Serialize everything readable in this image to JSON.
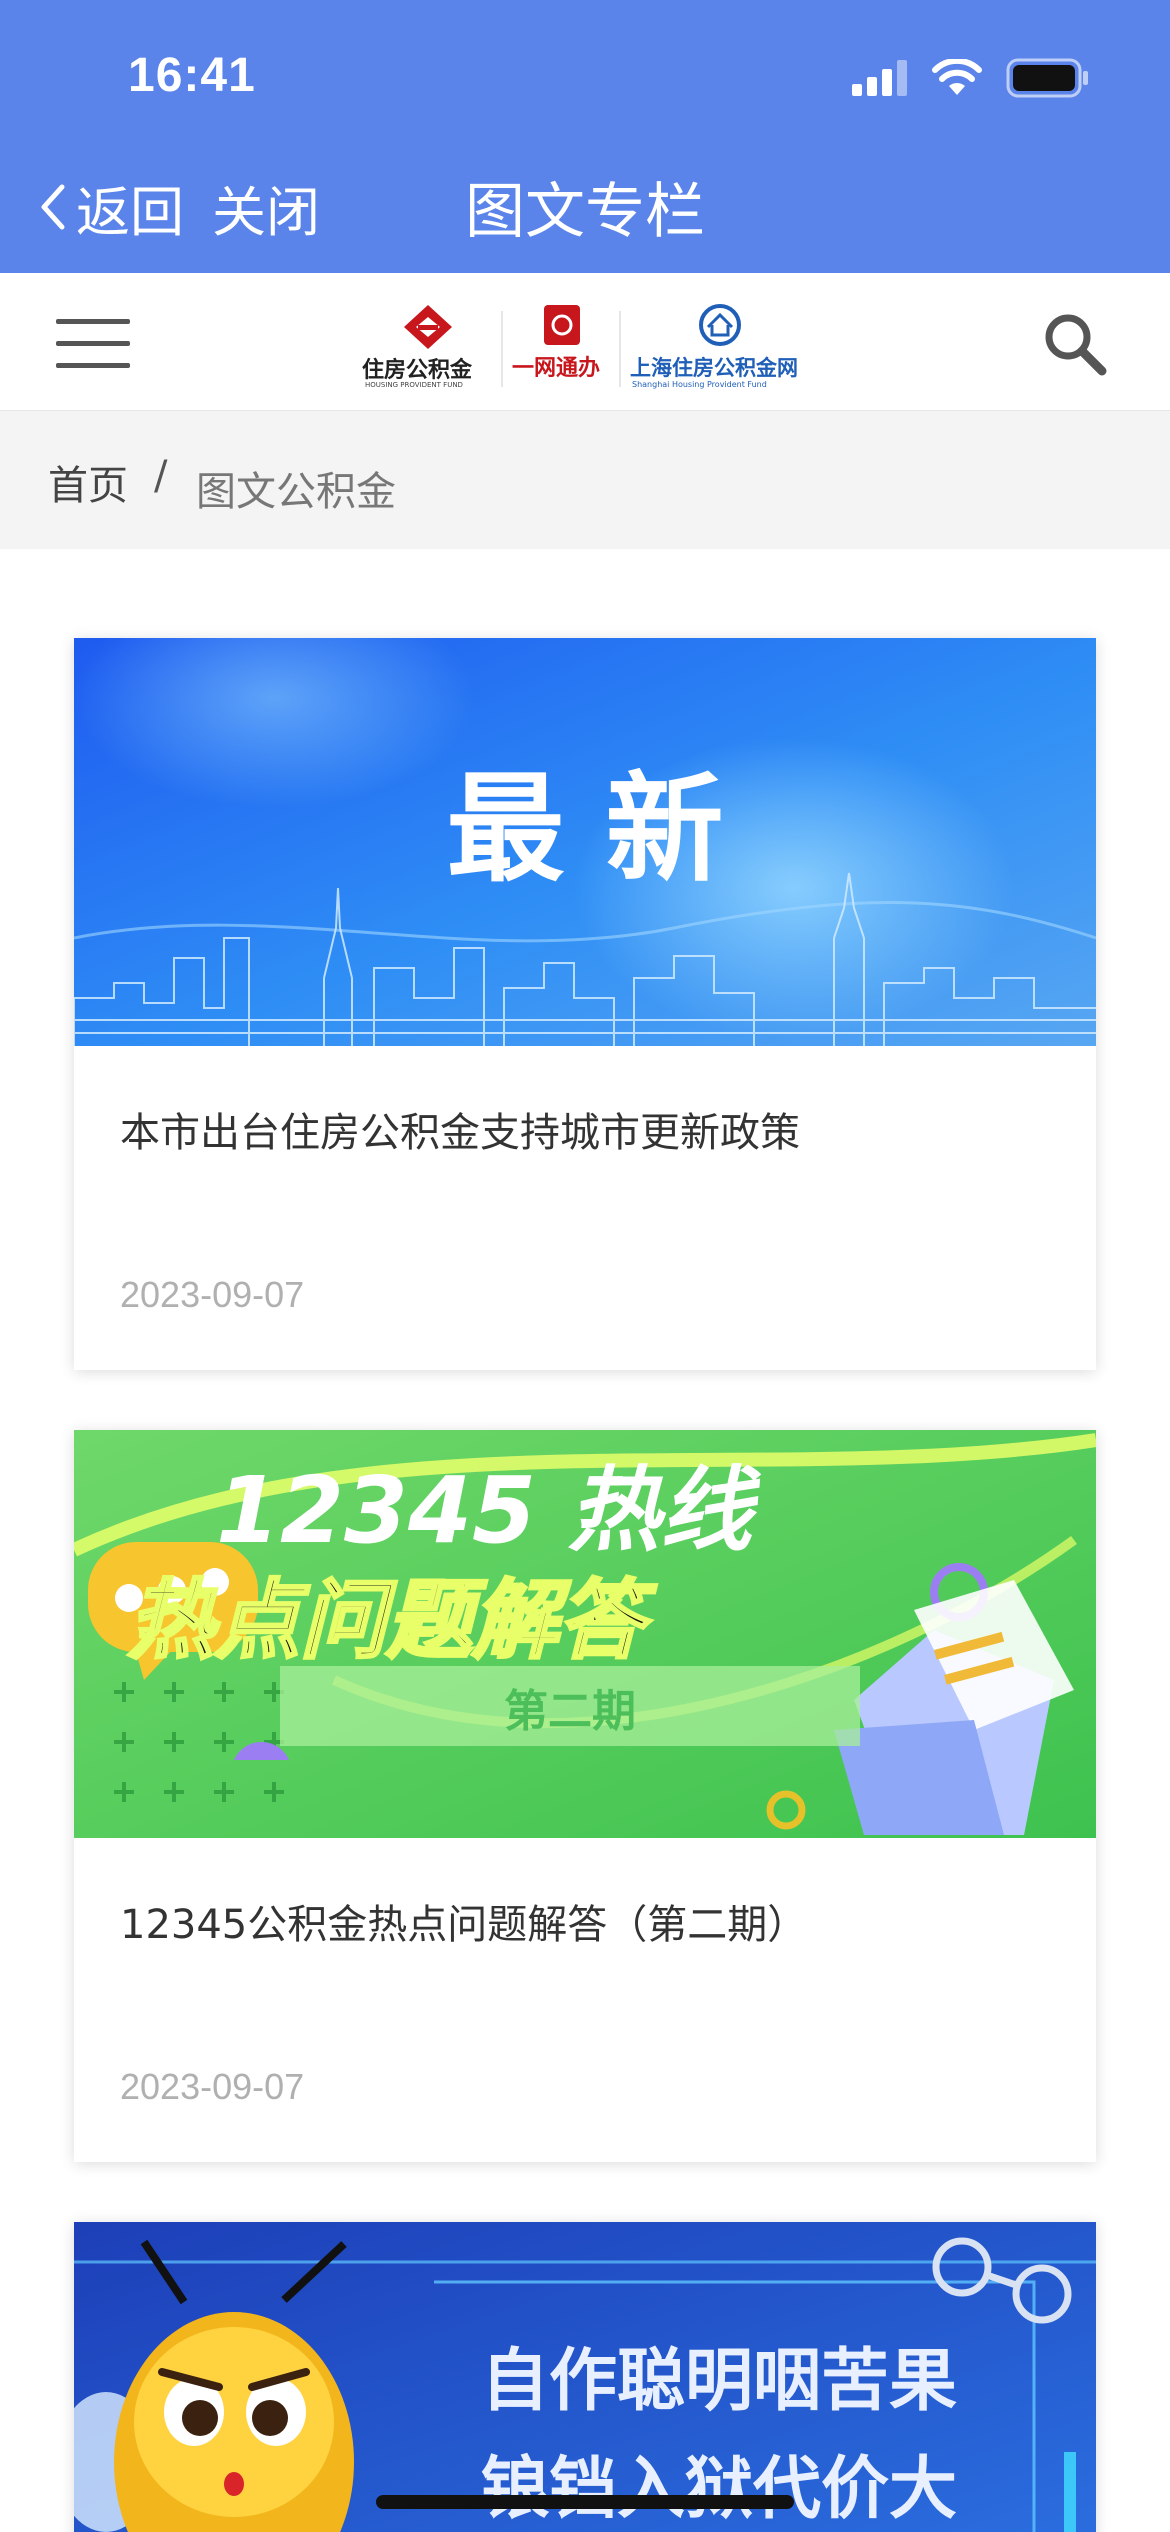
{
  "status_bar": {
    "time": "16:41"
  },
  "nav": {
    "back_label": "返回",
    "close_label": "关闭",
    "title": "图文专栏"
  },
  "header": {
    "logo": {
      "part1_cn": "住房公积金",
      "part1_en": "HOUSING PROVIDENT FUND",
      "part2_cn": "一网通办",
      "part3_cn": "上海住房公积金网",
      "part3_en": "Shanghai Housing Provident Fund"
    }
  },
  "breadcrumb": {
    "home": "首页",
    "separator": "/",
    "current": "图文公积金"
  },
  "articles": [
    {
      "image_text": "最 新",
      "title": "本市出台住房公积金支持城市更新政策",
      "date": "2023-09-07"
    },
    {
      "image_text_line1": "12345 热线",
      "image_text_line2": "热点问题解答",
      "image_text_line3": "第二期",
      "title": "12345公积金热点问题解答（第二期）",
      "date": "2023-09-07"
    },
    {
      "image_text_line1": "自作聪明咽苦果",
      "image_text_line2": "锒铛入狱代价大"
    }
  ],
  "colors": {
    "nav_bar": "#5b84ea",
    "breadcrumb_bg": "#f4f4f4",
    "date_text": "#b0b0b0",
    "logo_red": "#c8161d",
    "logo_blue": "#1f5fb8"
  }
}
